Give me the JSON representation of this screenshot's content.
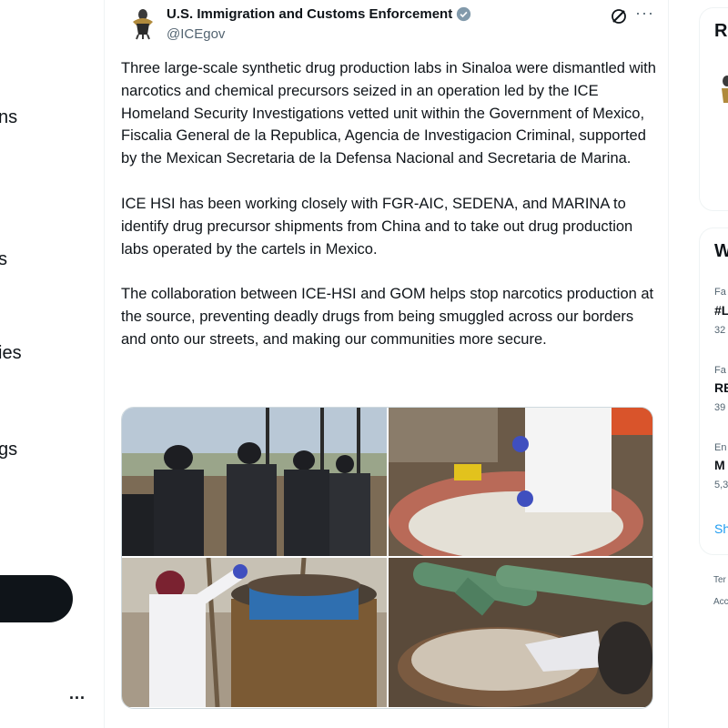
{
  "sidebar": {
    "nav_fragments": [
      "ns",
      "s",
      "ies",
      "gs"
    ],
    "more": "..."
  },
  "tweet": {
    "author_name": "U.S. Immigration and Customs Enforcement",
    "author_handle": "@ICEgov",
    "more": "···",
    "paragraphs": [
      "Three large-scale synthetic drug production labs in Sinaloa were dismantled with narcotics and chemical precursors seized in an operation led by the ICE Homeland Security Investigations vetted unit within the Government of Mexico, Fiscalia General de la Republica, Agencia de Investigacion Criminal, supported by the Mexican Secretaria de la Defensa Nacional and Secretaria de Marina.",
      "ICE HSI has been working closely with FGR-AIC, SEDENA, and MARINA to identify drug precursor shipments from China and to take out drug production labs operated by the cartels in Mexico.",
      "The collaboration between ICE-HSI and GOM helps stop narcotics production at the source, preventing deadly drugs from being smuggled across our borders and onto our streets, and making our communities more secure."
    ],
    "verified_color": "#829aab"
  },
  "right_column": {
    "card1_title": "R",
    "card2_title": "W",
    "trends": [
      {
        "category": "Fa",
        "name": "#L",
        "count": "32"
      },
      {
        "category": "Fa",
        "name": "RE",
        "count": "39"
      },
      {
        "category": "En",
        "name": "M",
        "count": "5,3"
      }
    ],
    "show_more": "Sh",
    "footer": [
      "Ter",
      "Acc"
    ]
  },
  "colors": {
    "text": "#0f1419",
    "secondary": "#536471",
    "accent": "#1d9bf0",
    "border": "#eff3f4"
  }
}
